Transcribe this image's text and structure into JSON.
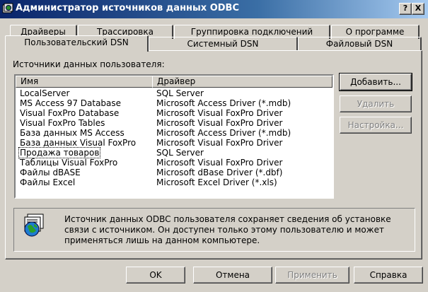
{
  "window": {
    "title": "Администратор источников данных ODBC",
    "help_label": "?",
    "close_label": "X"
  },
  "tabs_row1": [
    {
      "label": "Драйверы"
    },
    {
      "label": "Трассировка"
    },
    {
      "label": "Группировка подключений"
    },
    {
      "label": "О программе"
    }
  ],
  "tabs_row2": [
    {
      "label": "Пользовательский DSN",
      "active": true
    },
    {
      "label": "Системный DSN"
    },
    {
      "label": "Файловый DSN"
    }
  ],
  "panel": {
    "list_label": "Источники данных пользователя:",
    "columns": {
      "name": "Имя",
      "driver": "Драйвер"
    },
    "rows": [
      {
        "name": "LocalServer",
        "driver": "SQL Server"
      },
      {
        "name": "MS Access 97 Database",
        "driver": "Microsoft Access Driver (*.mdb)"
      },
      {
        "name": "Visual FoxPro Database",
        "driver": "Microsoft Visual FoxPro Driver"
      },
      {
        "name": "Visual FoxPro Tables",
        "driver": "Microsoft Visual FoxPro Driver"
      },
      {
        "name": "База данных MS Access",
        "driver": "Microsoft Access Driver (*.mdb)"
      },
      {
        "name": "База данных Visual FoxPro",
        "driver": "Microsoft Visual FoxPro Driver"
      },
      {
        "name": "Продажа товаров",
        "driver": "SQL Server",
        "focused": true
      },
      {
        "name": "Таблицы Visual FoxPro",
        "driver": "Microsoft Visual FoxPro Driver"
      },
      {
        "name": "Файлы dBASE",
        "driver": "Microsoft dBase Driver (*.dbf)"
      },
      {
        "name": "Файлы Excel",
        "driver": "Microsoft Excel Driver (*.xls)"
      }
    ],
    "buttons": {
      "add": "Добавить...",
      "remove": "Удалить",
      "configure": "Настройка..."
    },
    "info_text": "Источник данных ODBC пользователя сохраняет сведения об установке связи с источником.  Он доступен только этому пользователю и может применяться лишь на данном компьютере.",
    "info_icon": "odbc-globe-icon"
  },
  "footer": {
    "ok": "OK",
    "cancel": "Отмена",
    "apply": "Применить",
    "help": "Справка"
  },
  "colors": {
    "title_start": "#0a246a",
    "title_end": "#a6caf0",
    "face": "#d4d0c8"
  }
}
